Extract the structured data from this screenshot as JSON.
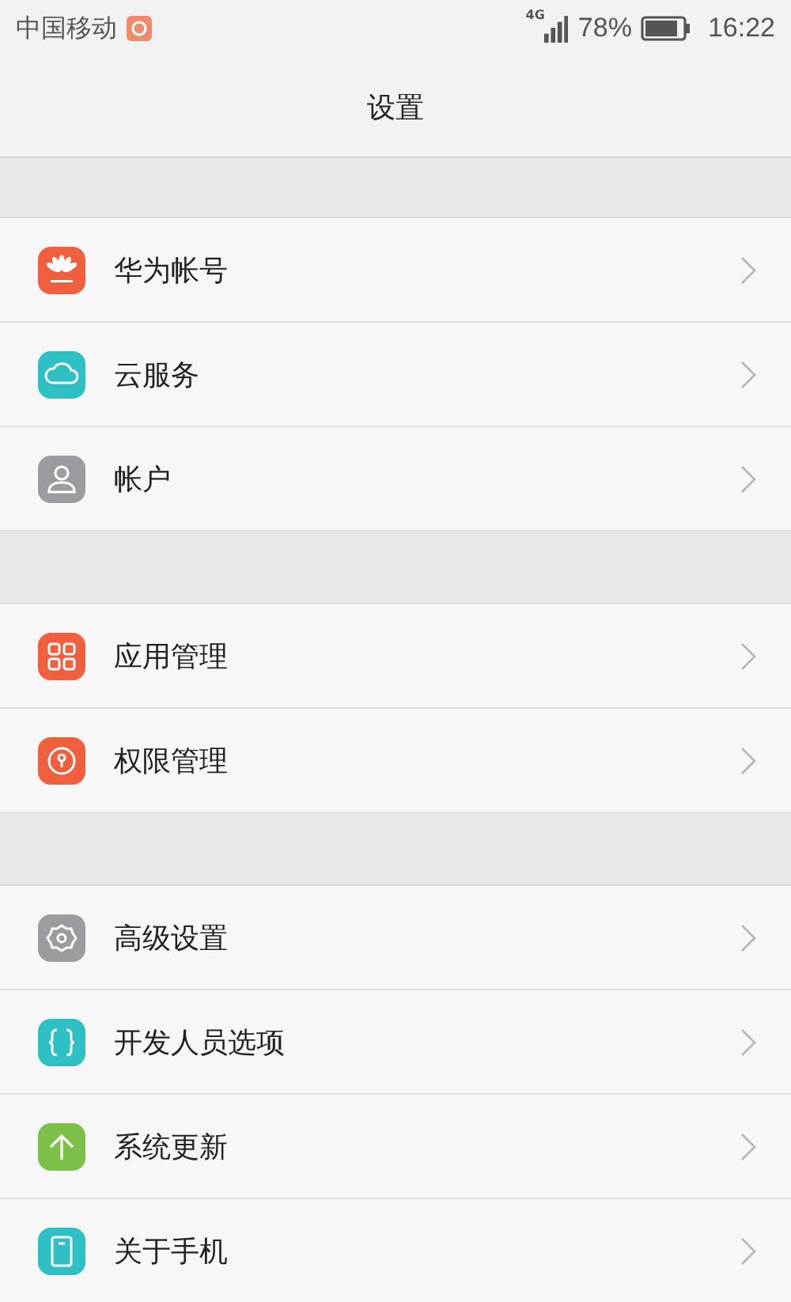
{
  "status_bar": {
    "carrier": "中国移动",
    "network": "4G",
    "battery": "78%",
    "time": "16:22"
  },
  "header": {
    "title": "设置"
  },
  "groups": [
    {
      "items": [
        {
          "label": "华为帐号",
          "kind": "huawei",
          "color": "#f0603e"
        },
        {
          "label": "云服务",
          "kind": "cloud",
          "color": "#2ec0c4"
        },
        {
          "label": "帐户",
          "kind": "person",
          "color": "#9a9ca0"
        }
      ]
    },
    {
      "items": [
        {
          "label": "应用管理",
          "kind": "grid",
          "color": "#f0603e"
        },
        {
          "label": "权限管理",
          "kind": "keyhole",
          "color": "#f0603e"
        }
      ]
    },
    {
      "items": [
        {
          "label": "高级设置",
          "kind": "gear",
          "color": "#9a9ca0"
        },
        {
          "label": "开发人员选项",
          "kind": "braces",
          "color": "#2ec0c4"
        },
        {
          "label": "系统更新",
          "kind": "arrow",
          "color": "#7cc04a"
        },
        {
          "label": "关于手机",
          "kind": "phone",
          "color": "#2ec0c4"
        }
      ]
    }
  ]
}
